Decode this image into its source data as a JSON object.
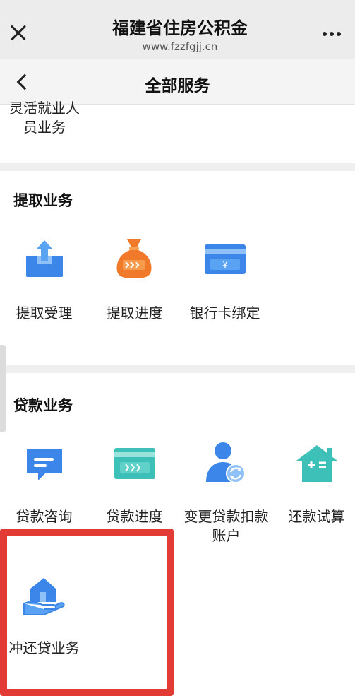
{
  "browser": {
    "title": "福建省住房公积金",
    "url": "www.fzzfgjj.cn"
  },
  "header": {
    "title": "全部服务"
  },
  "partial_item": {
    "label": "灵活就业人员业务"
  },
  "withdrawal": {
    "title": "提取业务",
    "items": [
      {
        "label": "提取受理",
        "icon": "upload-tray-icon"
      },
      {
        "label": "提取进度",
        "icon": "money-bag-icon"
      },
      {
        "label": "银行卡绑定",
        "icon": "bank-card-icon"
      }
    ]
  },
  "loan": {
    "title": "贷款业务",
    "items": [
      {
        "label": "贷款咨询",
        "icon": "chat-bubble-icon"
      },
      {
        "label": "贷款进度",
        "icon": "progress-card-icon"
      },
      {
        "label": "变更贷款扣款账户",
        "icon": "user-switch-icon"
      },
      {
        "label": "还款试算",
        "icon": "house-calculator-icon"
      },
      {
        "label": "冲还贷业务",
        "icon": "house-hand-icon"
      }
    ]
  },
  "colors": {
    "blue": "#3b86e8",
    "orange": "#f07a2a",
    "teal": "#3cc0b8",
    "highlight_red": "#e23a35"
  }
}
